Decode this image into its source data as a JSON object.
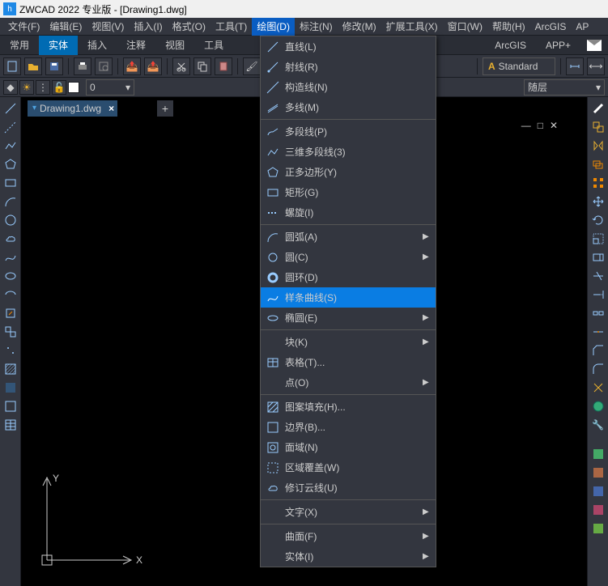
{
  "title": "ZWCAD 2022 专业版 - [Drawing1.dwg]",
  "menubar": [
    "文件(F)",
    "编辑(E)",
    "视图(V)",
    "插入(I)",
    "格式(O)",
    "工具(T)",
    "绘图(D)",
    "标注(N)",
    "修改(M)",
    "扩展工具(X)",
    "窗口(W)",
    "帮助(H)",
    "ArcGIS",
    "AP"
  ],
  "menubar_active": 6,
  "ribbontabs_left": [
    "常用",
    "实体",
    "插入",
    "注释",
    "视图",
    "工具"
  ],
  "ribbontabs_right": [
    "ArcGIS",
    "APP+"
  ],
  "ribbon_active": 1,
  "stylebox": "Standard",
  "layer_current": "0",
  "layer_right": "随层",
  "doc_tab": "Drawing1.dwg",
  "ucs_y": "Y",
  "ucs_x": "X",
  "menu": {
    "groups": [
      [
        {
          "icon": "line",
          "label": "直线(L)"
        },
        {
          "icon": "ray",
          "label": "射线(R)"
        },
        {
          "icon": "cline",
          "label": "构造线(N)"
        },
        {
          "icon": "mline",
          "label": "多线(M)"
        }
      ],
      [
        {
          "icon": "pline",
          "label": "多段线(P)"
        },
        {
          "icon": "pline3d",
          "label": "三维多段线(3)"
        },
        {
          "icon": "polygon",
          "label": "正多边形(Y)"
        },
        {
          "icon": "rect",
          "label": "矩形(G)"
        },
        {
          "icon": "spiral",
          "label": "螺旋(I)"
        }
      ],
      [
        {
          "icon": "arc",
          "label": "圆弧(A)",
          "sub": true
        },
        {
          "icon": "circle",
          "label": "圆(C)",
          "sub": true
        },
        {
          "icon": "donut",
          "label": "圆环(D)"
        },
        {
          "icon": "spline",
          "label": "样条曲线(S)",
          "hl": true
        },
        {
          "icon": "ellipse",
          "label": "椭圆(E)",
          "sub": true
        }
      ],
      [
        {
          "icon": "block",
          "label": "块(K)",
          "sub": true
        },
        {
          "icon": "table",
          "label": "表格(T)..."
        },
        {
          "icon": "point",
          "label": "点(O)",
          "sub": true
        }
      ],
      [
        {
          "icon": "hatch",
          "label": "图案填充(H)..."
        },
        {
          "icon": "boundary",
          "label": "边界(B)..."
        },
        {
          "icon": "region",
          "label": "面域(N)"
        },
        {
          "icon": "wipeout",
          "label": "区域覆盖(W)"
        },
        {
          "icon": "revcloud",
          "label": "修订云线(U)"
        }
      ],
      [
        {
          "icon": "text",
          "label": "文字(X)",
          "sub": true
        }
      ],
      [
        {
          "icon": "surface",
          "label": "曲面(F)",
          "sub": true
        },
        {
          "icon": "solid",
          "label": "实体(I)",
          "sub": true
        }
      ]
    ]
  }
}
